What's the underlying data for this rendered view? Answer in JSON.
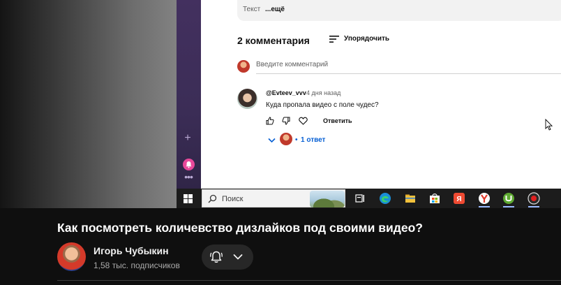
{
  "video_screen": {
    "description_box": {
      "text": "Текст",
      "more": "...ещё"
    },
    "comments": {
      "count_label": "2 комментария",
      "sort_label": "Упорядочить",
      "add_placeholder": "Введите комментарий",
      "items": [
        {
          "author": "@Evteev_vvv",
          "time": "4 дня назад",
          "text": "Куда пропала видео с поле чудес?",
          "reply_label": "Ответить",
          "replies_dot": "•",
          "replies_label": "1 ответ"
        }
      ]
    },
    "taskbar": {
      "search_placeholder": "Поиск",
      "apps": [
        "task-view-icon",
        "edge-icon",
        "file-explorer-icon",
        "store-icon",
        "yandex-icon",
        "yandex-browser-icon",
        "utorrent-icon",
        "recorder-icon"
      ]
    }
  },
  "video_info": {
    "title": "Как посмотреть количевство дизлайков под своими видео?",
    "channel_name": "Игорь Чубыкин",
    "subscribers": "1,58 тыс. подписчиков"
  },
  "colors": {
    "page_bg": "#0f0f0f",
    "link_blue": "#065fd4",
    "button_bg": "#272727"
  }
}
